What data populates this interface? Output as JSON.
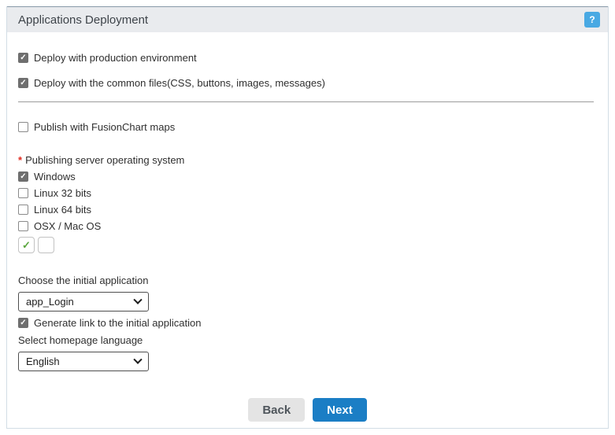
{
  "header": {
    "title": "Applications Deployment",
    "help_label": "?"
  },
  "icons": {
    "check": "✓"
  },
  "colors": {
    "next_blue": "#1b7ec5",
    "help_blue": "#49a9e3",
    "required_red": "#e02b20",
    "check_green": "#5aa63e"
  },
  "checkboxes": {
    "deploy_production": {
      "label": "Deploy with production environment",
      "checked": true
    },
    "deploy_common": {
      "label": "Deploy with the common files(CSS, buttons, images, messages)",
      "checked": true
    },
    "fusionchart": {
      "label": "Publish with FusionChart maps",
      "checked": false
    }
  },
  "os_section": {
    "required_marker": "*",
    "label": "Publishing server operating system",
    "options": [
      {
        "label": "Windows",
        "checked": true
      },
      {
        "label": "Linux 32 bits",
        "checked": false
      },
      {
        "label": "Linux 64 bits",
        "checked": false
      },
      {
        "label": "OSX / Mac OS",
        "checked": false
      }
    ]
  },
  "initial_app": {
    "label": "Choose the initial application",
    "selected": "app_Login"
  },
  "generate_link": {
    "label": "Generate link to the initial application",
    "checked": true
  },
  "language": {
    "label": "Select homepage language",
    "selected": "English"
  },
  "buttons": {
    "back": "Back",
    "next": "Next"
  }
}
